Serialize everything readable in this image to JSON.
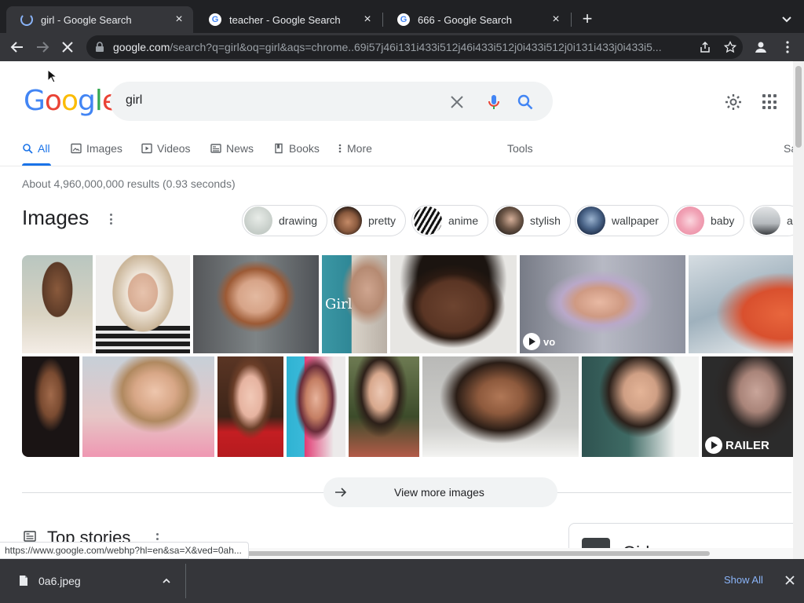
{
  "browser": {
    "tabs": [
      {
        "title": "girl - Google Search",
        "active": true,
        "loading": true
      },
      {
        "title": "teacher - Google Search",
        "active": false
      },
      {
        "title": "666 - Google Search",
        "active": false
      }
    ],
    "url_host": "google.com",
    "url_rest": "/search?q=girl&oq=girl&aqs=chrome..69i57j46i131i433i512j46i433i512j0i433i512j0i131i433j0i433i5..."
  },
  "search": {
    "logo": "Google",
    "query": "girl",
    "tabs": [
      {
        "label": "All",
        "icon": "search-icon",
        "active": true
      },
      {
        "label": "Images",
        "icon": "image-icon"
      },
      {
        "label": "Videos",
        "icon": "play-icon"
      },
      {
        "label": "News",
        "icon": "news-icon"
      },
      {
        "label": "Books",
        "icon": "book-icon"
      },
      {
        "label": "More",
        "icon": "kebab-icon"
      }
    ],
    "tools_label": "Tools",
    "safesearch_partial": "Sa",
    "result_stats": "About 4,960,000,000 results (0.93 seconds)"
  },
  "images": {
    "title": "Images",
    "chips": [
      "drawing",
      "pretty",
      "anime",
      "stylish",
      "wallpaper",
      "baby",
      "a"
    ],
    "video_badge": "vo",
    "trailer_badge": "RAILER",
    "view_more": "View more images"
  },
  "top_stories": {
    "title": "Top stories",
    "side_title": "Girl"
  },
  "status_url": "https://www.google.com/webhp?hl=en&sa=X&ved=0ah...",
  "downloads": {
    "filename": "0a6.jpeg",
    "show_all": "Show All"
  },
  "colors": {
    "accent": "#1a73e8",
    "chrome_dark": "#202124",
    "chrome_toolbar": "#35363a"
  }
}
